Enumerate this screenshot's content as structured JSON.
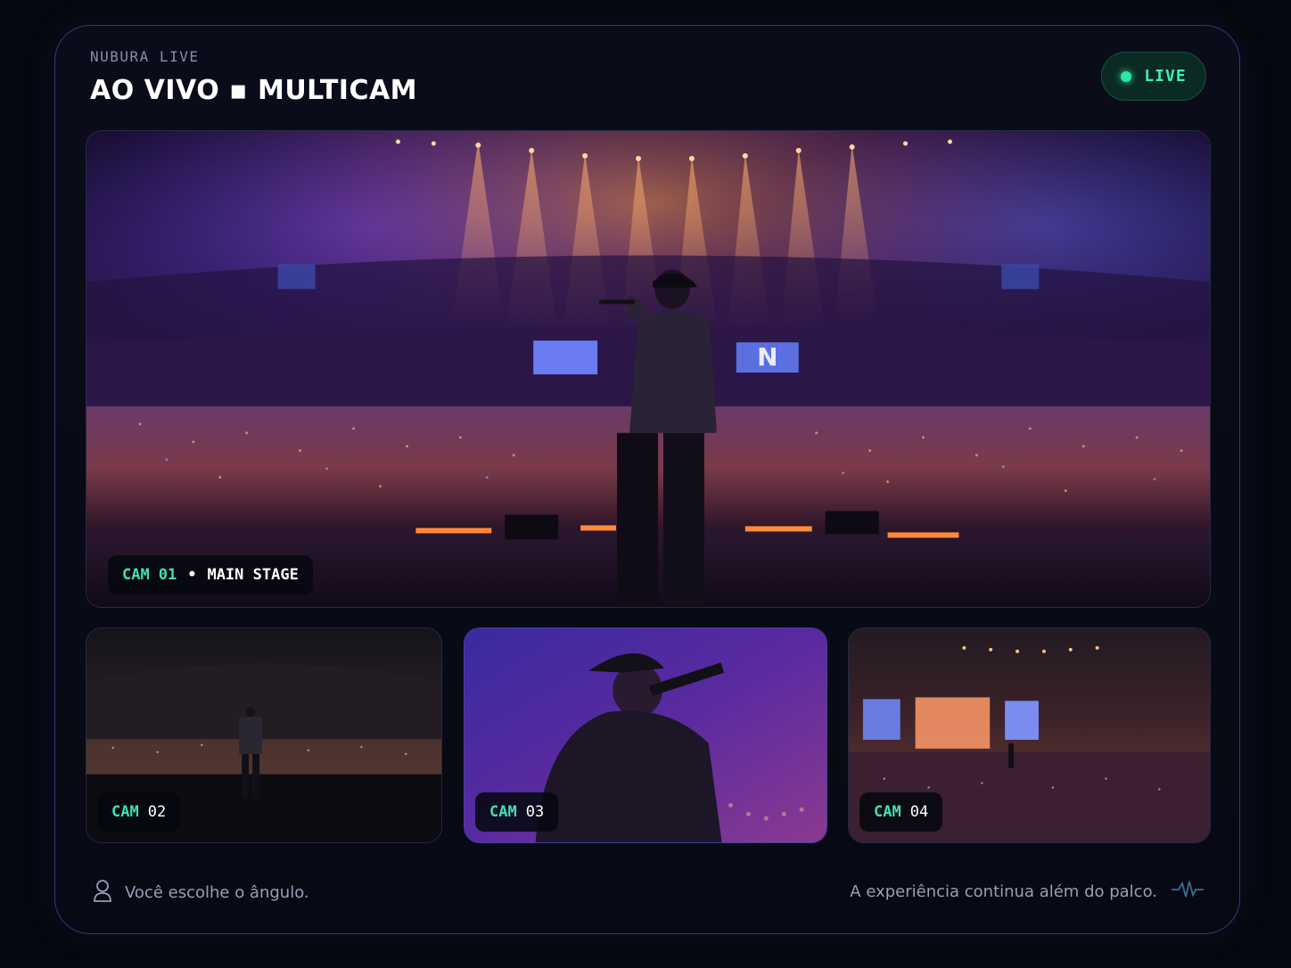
{
  "header": {
    "brand": "NUBURA LIVE",
    "title": "AO VIVO ▪ MULTICAM",
    "live_label": "LIVE"
  },
  "cameras": [
    {
      "cam_word": "CAM",
      "cam_number": "01",
      "separator": "•",
      "name": "MAIN STAGE"
    },
    {
      "cam_word": "CAM",
      "cam_number": "02"
    },
    {
      "cam_word": "CAM",
      "cam_number": "03"
    },
    {
      "cam_word": "CAM",
      "cam_number": "04"
    }
  ],
  "footer": {
    "left_text": "Você escolhe o ângulo.",
    "right_text": "A experiência continua além do palco.",
    "left_icon": "user-icon",
    "right_icon": "audio-wave-icon"
  },
  "colors": {
    "accent": "#3fe0b4",
    "live_bg": "#0c2a24",
    "border": "#3b3580"
  }
}
